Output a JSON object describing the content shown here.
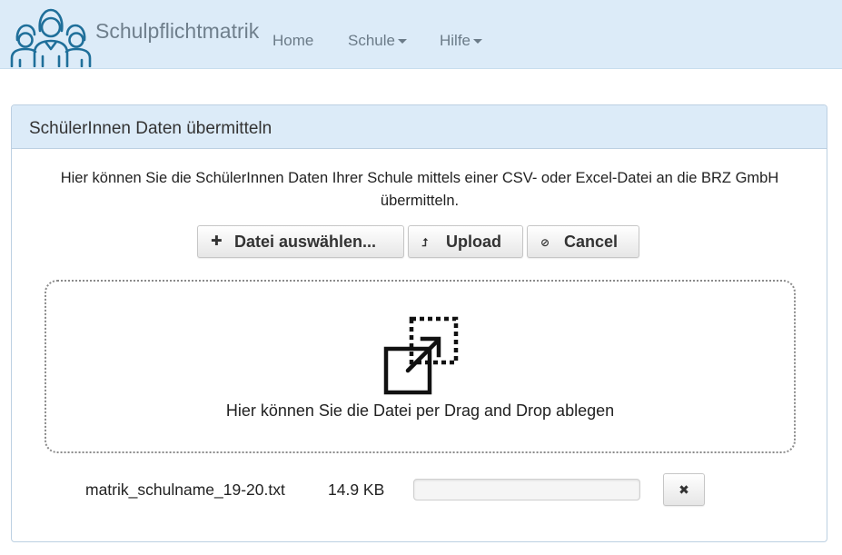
{
  "navbar": {
    "brand": "Schulpflichtmatrik",
    "logo_icon": "people-group-icon",
    "items": [
      {
        "label": "Home",
        "dropdown": false
      },
      {
        "label": "Schule",
        "dropdown": true
      },
      {
        "label": "Hilfe",
        "dropdown": true
      }
    ]
  },
  "panel": {
    "title": "SchülerInnen Daten übermitteln",
    "intro": "Hier können Sie die SchülerInnen Daten Ihrer Schule mittels einer CSV- oder Excel-Datei an die BRZ GmbH übermitteln.",
    "buttons": {
      "select": {
        "label": "Datei auswählen...",
        "icon": "plus-icon"
      },
      "upload": {
        "label": "Upload",
        "icon": "upload-arrow-icon"
      },
      "cancel": {
        "label": "Cancel",
        "icon": "ban-icon"
      }
    },
    "dropzone": {
      "icon": "drag-drop-icon",
      "text": "Hier können Sie die Datei per Drag and Drop ablegen"
    },
    "file": {
      "name": "matrik_schulname_19-20.txt",
      "size": "14.9 KB",
      "progress": 0,
      "remove_icon": "close-icon"
    }
  },
  "colors": {
    "header_bg": "#dcebf8",
    "panel_border": "#bcd0e2",
    "logo": "#1f6f9a",
    "nav_text": "#6b7b88"
  }
}
